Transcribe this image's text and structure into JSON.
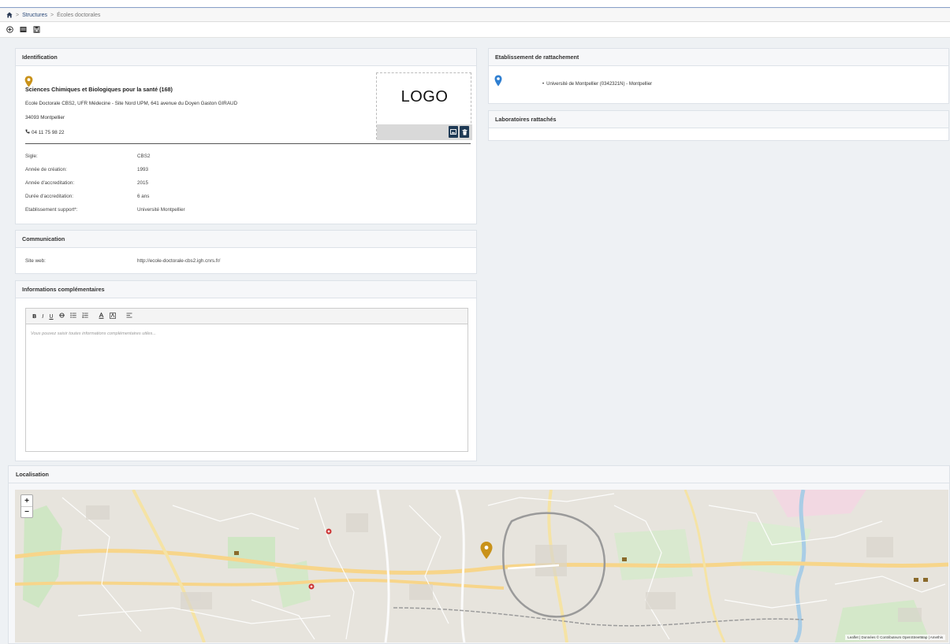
{
  "breadcrumb": {
    "items": [
      "Structures",
      "Écoles doctorales"
    ],
    "separator": ">"
  },
  "identification": {
    "title": "Identification",
    "name": "Sciences Chimiques et Biologiques pour la santé (168)",
    "address_line1": "Ecole Doctorale CBS2, UFR Médecine - Site Nord UPM, 641 avenue du Doyen Gaston GIRAUD",
    "address_line2": "34093 Montpellier",
    "phone": "04 11 75 98 22",
    "logo_text": "LOGO",
    "fields": [
      {
        "label": "Sigle:",
        "value": "CBS2"
      },
      {
        "label": "Année de création:",
        "value": "1993"
      },
      {
        "label": "Année d'accreditation:",
        "value": "2015"
      },
      {
        "label": "Durée d'accreditation:",
        "value": "6 ans"
      },
      {
        "label": "Etablissement support*:",
        "value": "Université Montpellier"
      }
    ]
  },
  "communication": {
    "title": "Communication",
    "site_label": "Site web:",
    "site_value": "http://ecole-doctorale-cbs2.igh.cnrs.fr/"
  },
  "complements": {
    "title": "Informations complémentaires",
    "placeholder": "Vous pouvez saisir toutes informations complémentaires utiles..."
  },
  "rattachement": {
    "title": "Etablissement de rattachement",
    "item": "Université de Montpellier (0342321N) - Montpellier"
  },
  "laboratoires": {
    "title": "Laboratoires rattachés"
  },
  "localisation": {
    "title": "Localisation",
    "zoom_in": "+",
    "zoom_out": "−",
    "attribution": "Leaflet | Données © Contributeurs OpenStreetMap | Amethis"
  },
  "colors": {
    "accent": "#1f3a55",
    "marker_gold": "#c9921a",
    "marker_blue": "#2f7fd1"
  }
}
